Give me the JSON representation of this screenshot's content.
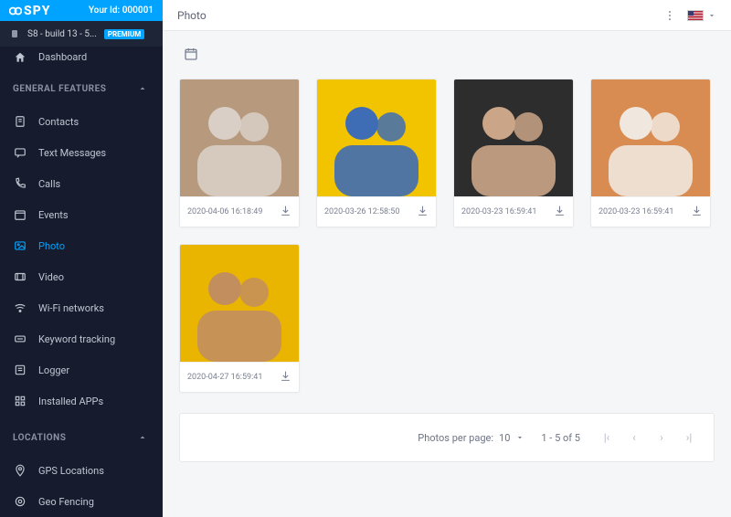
{
  "brand": {
    "name": "SPY",
    "account_label": "Your Id:",
    "account_id": "000001"
  },
  "device": {
    "label": "S8 - build 13 - 5...",
    "badge": "PREMIUM"
  },
  "dashboard_label": "Dashboard",
  "sections": [
    {
      "title": "GENERAL FEATURES",
      "items": [
        {
          "icon": "contacts-icon",
          "label": "Contacts"
        },
        {
          "icon": "message-icon",
          "label": "Text Messages"
        },
        {
          "icon": "phone-icon",
          "label": "Calls"
        },
        {
          "icon": "calendar-icon",
          "label": "Events"
        },
        {
          "icon": "image-icon",
          "label": "Photo",
          "active": true
        },
        {
          "icon": "video-icon",
          "label": "Video"
        },
        {
          "icon": "wifi-icon",
          "label": "Wi-Fi networks"
        },
        {
          "icon": "keyboard-icon",
          "label": "Keyword tracking"
        },
        {
          "icon": "log-icon",
          "label": "Logger"
        },
        {
          "icon": "apps-icon",
          "label": "Installed APPs"
        }
      ]
    },
    {
      "title": "LOCATIONS",
      "items": [
        {
          "icon": "pin-icon",
          "label": "GPS Locations"
        },
        {
          "icon": "target-icon",
          "label": "Geo Fencing"
        }
      ]
    }
  ],
  "page": {
    "title": "Photo"
  },
  "photos": [
    {
      "timestamp": "2020-04-06 16:18:49"
    },
    {
      "timestamp": "2020-03-26 12:58:50"
    },
    {
      "timestamp": "2020-03-23 16:59:41"
    },
    {
      "timestamp": "2020-03-23 16:59:41"
    },
    {
      "timestamp": "2020-04-27 16:59:41"
    }
  ],
  "pagination": {
    "per_page_label": "Photos per page:",
    "per_page_value": "10",
    "range": "1 - 5 of 5"
  }
}
